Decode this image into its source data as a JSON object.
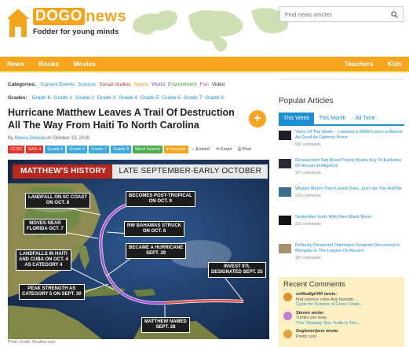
{
  "header": {
    "logo_dogo": "DOGO",
    "logo_news": "news",
    "tagline": "Fodder for young minds",
    "search_placeholder": "Find news articles"
  },
  "nav": {
    "left": [
      "News",
      "Books",
      "Movies"
    ],
    "right": [
      "Teachers",
      "Kids"
    ]
  },
  "article": {
    "categories_label": "Categories:",
    "categories": [
      {
        "label": "Current Events",
        "color": "#1c8fd4"
      },
      {
        "label": "Science",
        "color": "#2aa6c9"
      },
      {
        "label": "Social studies",
        "color": "#c0392b"
      },
      {
        "label": "Sports",
        "color": "#f0a000"
      },
      {
        "label": "World",
        "color": "#9b3fb5"
      },
      {
        "label": "Environment",
        "color": "#3aa335"
      },
      {
        "label": "Fun",
        "color": "#e53a8a"
      },
      {
        "label": "Video",
        "color": "#333333"
      }
    ],
    "grades_label": "Grades:",
    "grades": [
      "Grade K",
      "Grade 1",
      "Grade 2",
      "Grade 3",
      "Grade 4",
      "Grade 5",
      "Grade 6",
      "Grade 7",
      "Grade 8"
    ],
    "title": "Hurricane Matthew Leaves A Trail Of Destruction All The Way From Haiti To North Carolina",
    "byline_prefix": "By",
    "author": "Meera Dolasia",
    "byline_suffix": "on October 10, 2016",
    "tags": [
      {
        "label": "CCSS",
        "color": "#e2342b"
      },
      {
        "label": "NAS-4",
        "color": "#e2342b"
      },
      {
        "label": "Grade 5",
        "color": "#3fa7e0"
      },
      {
        "label": "Grade 6",
        "color": "#3fa7e0"
      },
      {
        "label": "Grade 7",
        "color": "#3fa7e0"
      },
      {
        "label": "Grade 8",
        "color": "#3fa7e0"
      },
      {
        "label": "Word Search",
        "color": "#4cae4c"
      },
      {
        "label": "♥ Favorite",
        "color": "#f7a51c"
      }
    ],
    "actions": [
      "⌁ Embed",
      "✉ Email",
      "⎙ Print"
    ],
    "credit": "Photo Credit: Weather.com"
  },
  "image": {
    "banner_red": "MATTHEW'S HISTORY",
    "banner_gray": "LATE SEPTEMBER-EARLY OCTOBER",
    "labels": {
      "landfall_sc": "LANDFALL ON SC COAST\nON OCT. 8",
      "post_tropical": "BECOMES POST-TROPICAL\nON OCT. 9",
      "moves_near": "MOVES NEAR\nFLORIDA OCT. 7",
      "bahamas": "NW BAHAMAS STRUCK\nON OCT. 6",
      "becomes_hurricane": "BECAME A HURRICANE\nSEPT. 29",
      "haiti_cuba": "LANDFALLS IN HAITI\nAND CUBA ON OCT. 4\nAS CATEGORY 4",
      "peak": "PEAK STRENGTH AS\nCATEGORY 5 ON SEPT. 30",
      "invest": "INVEST 97L\nDESIGNATED SEPT. 25",
      "named": "MATTHEW NAMED\nSEPT. 28"
    }
  },
  "sidebar": {
    "popular_title": "Popular Articles",
    "tabs": [
      "This Week",
      "This Month",
      "All Time"
    ],
    "items": [
      {
        "title": "Video Of The Week -- Lebolson's BMW Letron Is Almost As Good As Optimus Prime",
        "count": "582 comments",
        "thumb": "#1d1d2b"
      },
      {
        "title": "Researchers Say Blood Thirsty Brains Key To Evolution Of Human Intelligence",
        "count": "227 comments",
        "thumb": "#2b2b36"
      },
      {
        "title": "Whales Mourn Their Loved Ones, Just Like You And Me",
        "count": "216 comments",
        "thumb": "#3b6d8f"
      },
      {
        "title": "September Ends With Rare Black Moon",
        "count": "210 comments",
        "thumb": "#111111"
      },
      {
        "title": "Perfectly Preserved Titanosaur Footprint Discovered In Mongolia Is The Largest On Record",
        "count": "157 comments",
        "thumb": "#a8906b"
      }
    ],
    "comments_title": "Recent Comments",
    "comments": [
      {
        "user": "softballgirl00 wrote:",
        "snippet": "that science rules Any favorite ...",
        "link": "Cycle for Science: A Cross Coast...",
        "avatar": "#e38f2e"
      },
      {
        "user": "Steven wrote:",
        "snippet": "Turtles are slow.",
        "link": "This 'Glowing' Sea Turtle Is The...",
        "avatar": "#c77bd6"
      },
      {
        "user": "Doglover/jenn wrote:",
        "snippet": "Pretty cool",
        "link": "",
        "avatar": "#e0a23a"
      }
    ]
  }
}
